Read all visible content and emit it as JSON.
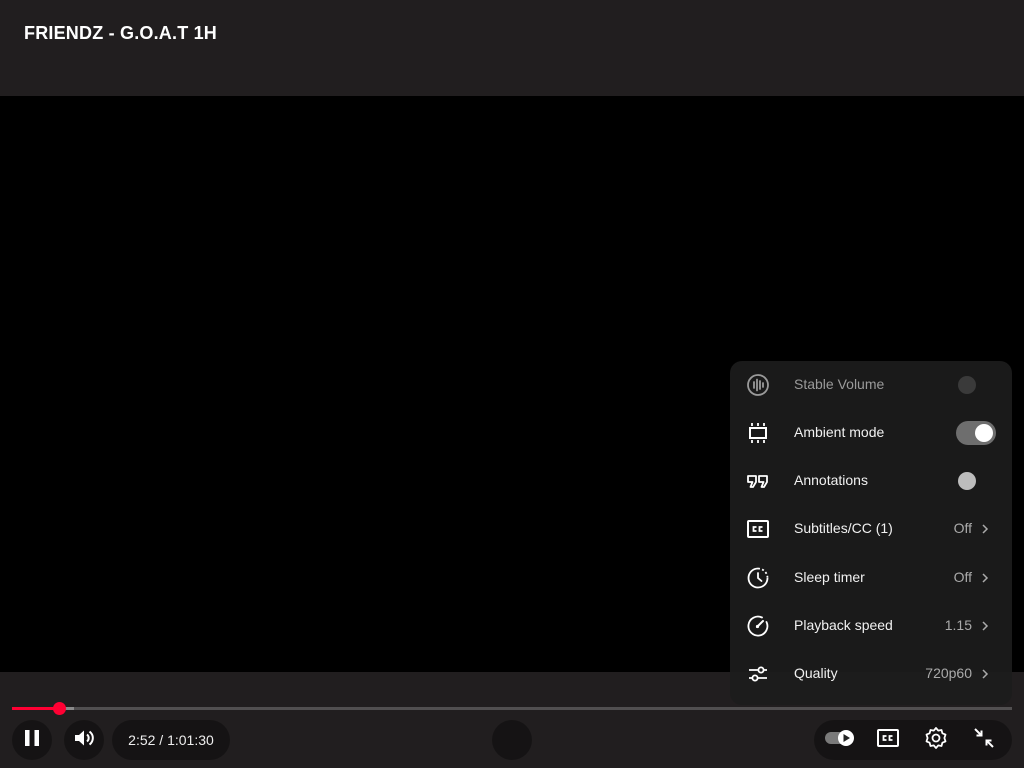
{
  "video": {
    "title": "FRIENDZ - G.O.A.T 1H"
  },
  "settings_menu": {
    "items": [
      {
        "label": "Stable Volume",
        "icon": "stable-volume-icon",
        "control": "toggle",
        "state": "disabled"
      },
      {
        "label": "Ambient mode",
        "icon": "ambient-mode-icon",
        "control": "toggle",
        "state": "on"
      },
      {
        "label": "Annotations",
        "icon": "annotations-icon",
        "control": "toggle",
        "state": "off"
      },
      {
        "label": "Subtitles/CC (1)",
        "icon": "subtitles-icon",
        "value": "Off"
      },
      {
        "label": "Sleep timer",
        "icon": "sleep-timer-icon",
        "value": "Off"
      },
      {
        "label": "Playback speed",
        "icon": "playback-speed-icon",
        "value": "1.15"
      },
      {
        "label": "Quality",
        "icon": "quality-icon",
        "value": "720p60"
      }
    ]
  },
  "player": {
    "current_time": "2:52",
    "duration": "1:01:30",
    "time_display": "2:52 / 1:01:30",
    "played_fraction": 0.047,
    "buffered_fraction": 0.062
  },
  "colors": {
    "accent": "#ff0033",
    "background": "#211e1f",
    "video": "#000000"
  }
}
